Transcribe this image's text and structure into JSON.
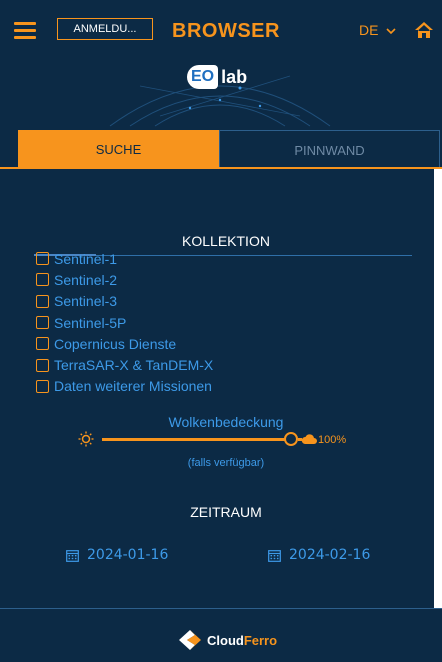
{
  "header": {
    "login_label": "ANMELDU...",
    "title": "BROWSER",
    "language": "DE",
    "icons": [
      "menu-icon",
      "chevron-down-icon",
      "home-icon"
    ]
  },
  "banner": {
    "logo_badge": "EO",
    "logo_word": "lab"
  },
  "tabs": [
    {
      "label": "SUCHE",
      "active": true
    },
    {
      "label": "PINNWAND",
      "active": false
    }
  ],
  "collection": {
    "title": "KOLLEKTION",
    "items": [
      {
        "label": "Sentinel-1",
        "checked": false
      },
      {
        "label": "Sentinel-2",
        "checked": false
      },
      {
        "label": "Sentinel-3",
        "checked": false
      },
      {
        "label": "Sentinel-5P",
        "checked": false
      },
      {
        "label": "Copernicus Dienste",
        "checked": false
      },
      {
        "label": "TerraSAR-X & TanDEM-X",
        "checked": false
      },
      {
        "label": "Daten weiterer Missionen",
        "checked": false
      }
    ]
  },
  "cloud_cover": {
    "title": "Wolkenbedeckung",
    "value": "100%",
    "note": "(falls verfügbar)",
    "slider_value": 1.0
  },
  "time_range": {
    "title": "ZEITRAUM",
    "start": "2024-01-16",
    "end": "2024-02-16"
  },
  "footer": {
    "brand_part1": "Cloud",
    "brand_part2": "Ferro"
  },
  "colors": {
    "background": "#0c2a45",
    "accent": "#f7941d",
    "link_blue": "#3d9ae8"
  }
}
